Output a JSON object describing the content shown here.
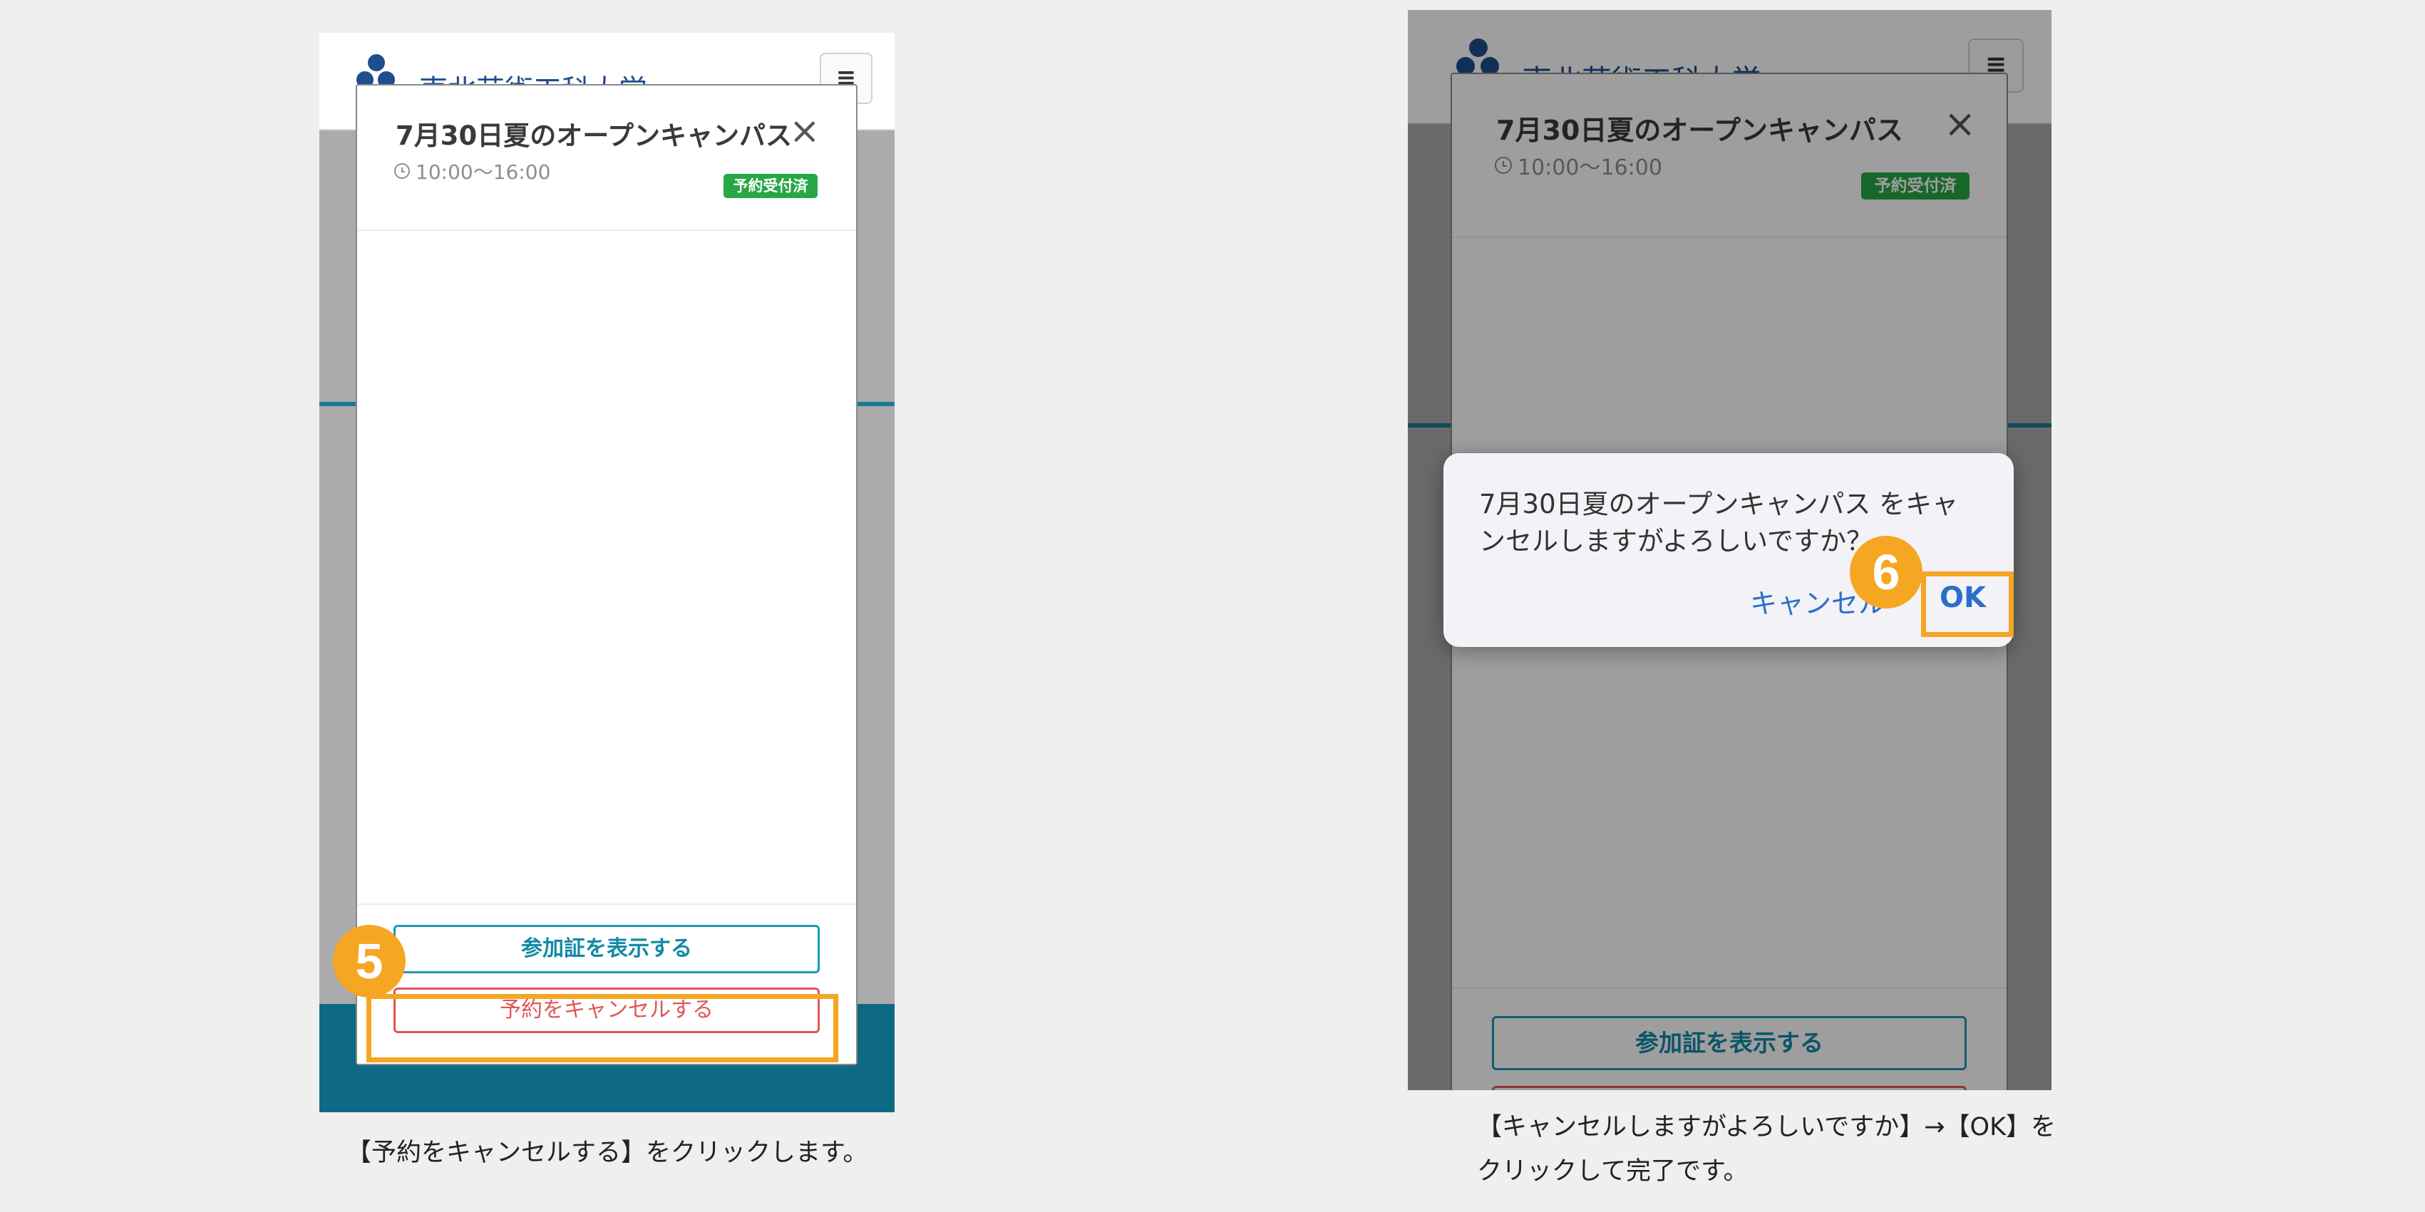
{
  "colors": {
    "accent_orange": "#f5a623",
    "teal": "#0e6a84",
    "badge_green": "#28a745",
    "primary_blue": "#1a9ab8",
    "danger_red": "#e05656",
    "dialog_link_blue": "#2c6ec9"
  },
  "left_screen": {
    "header": {
      "university_name": "東北芸術工科大学",
      "menu_icon": "≡"
    },
    "modal": {
      "title": "7月30日夏のオープンキャンパス",
      "close_icon": "×",
      "time": "10:00〜16:00",
      "status_badge": "予約受付済",
      "show_ticket_button": "参加証を表示する",
      "cancel_reservation_button": "予約をキャンセルする"
    },
    "step_number": "5"
  },
  "left_caption": "【予約をキャンセルする】をクリックします。",
  "right_screen": {
    "header": {
      "university_name": "東北芸術工科大学",
      "menu_icon": "≡"
    },
    "modal": {
      "title": "7月30日夏のオープンキャンパス",
      "close_icon": "×",
      "time": "10:00〜16:00",
      "status_badge": "予約受付済",
      "show_ticket_button": "参加証を表示する"
    },
    "dialog": {
      "message": "7月30日夏のオープンキャンパス をキャンセルしますがよろしいですか？",
      "cancel_label": "キャンセル",
      "ok_label": "OK"
    },
    "step_number": "6"
  },
  "right_caption": {
    "line1": "【キャンセルしますがよろしいですか】→【OK】を",
    "line2": "クリックして完了です。"
  }
}
